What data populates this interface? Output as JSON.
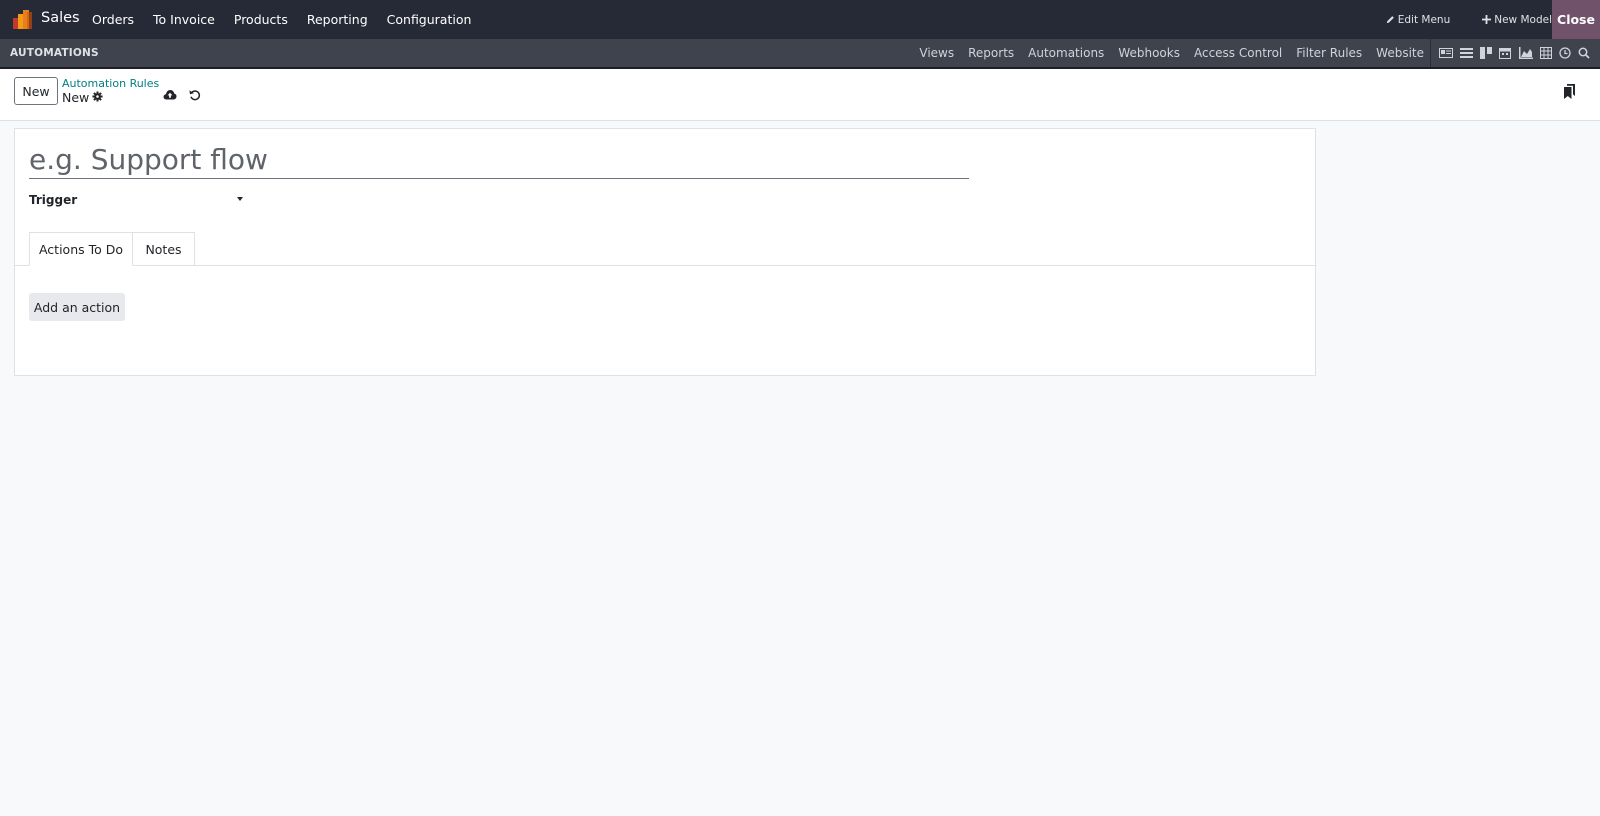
{
  "navbar": {
    "app_name": "Sales",
    "menu": [
      "Orders",
      "To Invoice",
      "Products",
      "Reporting",
      "Configuration"
    ],
    "edit_menu": "Edit Menu",
    "new_model": "New Model",
    "close": "Close"
  },
  "studio": {
    "title": "AUTOMATIONS",
    "menu": [
      "Views",
      "Reports",
      "Automations",
      "Webhooks",
      "Access Control",
      "Filter Rules",
      "Website"
    ],
    "view_icons": [
      "form-view-icon",
      "list-view-icon",
      "kanban-view-icon",
      "calendar-view-icon",
      "graph-view-icon",
      "pivot-view-icon",
      "activity-view-icon",
      "search-view-icon"
    ]
  },
  "control_panel": {
    "new_button": "New",
    "breadcrumb_parent": "Automation Rules",
    "breadcrumb_current": "New"
  },
  "form": {
    "name_placeholder": "e.g. Support flow",
    "name_value": "",
    "trigger_label": "Trigger",
    "trigger_value": "",
    "tabs": [
      "Actions To Do",
      "Notes"
    ],
    "active_tab": "Actions To Do",
    "add_action": "Add an action"
  },
  "colors": {
    "navbar_bg": "#262a36",
    "subbar_bg": "#3f434d",
    "close_bg": "#71526b",
    "link": "#017e84",
    "page_bg": "#f8f9fa"
  }
}
